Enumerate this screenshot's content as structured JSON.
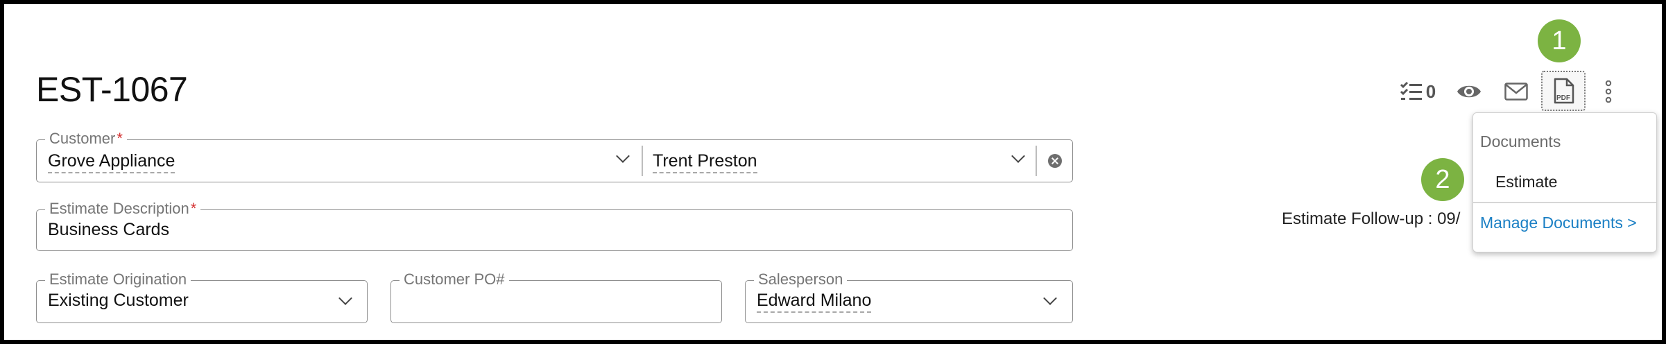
{
  "page": {
    "title": "EST-1067"
  },
  "toolbar": {
    "checklist_count": "0",
    "pdf_label": "PDF",
    "icons": [
      "checklist-icon",
      "eye-icon",
      "mail-icon",
      "pdf-icon",
      "more-vertical-icon"
    ]
  },
  "badges": {
    "one": "1",
    "two": "2"
  },
  "customer": {
    "label": "Customer",
    "required": "*",
    "company": "Grove Appliance",
    "contact": "Trent Preston"
  },
  "description": {
    "label": "Estimate Description",
    "required": "*",
    "value": "Business Cards"
  },
  "origination": {
    "label": "Estimate Origination",
    "value": "Existing Customer"
  },
  "customer_po": {
    "label": "Customer PO#",
    "value": ""
  },
  "salesperson": {
    "label": "Salesperson",
    "value": "Edward Milano"
  },
  "followup": {
    "text": "Estimate Follow-up : 09/"
  },
  "documents_menu": {
    "header": "Documents",
    "item": "Estimate",
    "link": "Manage Documents >"
  },
  "colors": {
    "badge": "#7cb342",
    "link": "#1a7fc4",
    "required": "#d32f2f"
  }
}
